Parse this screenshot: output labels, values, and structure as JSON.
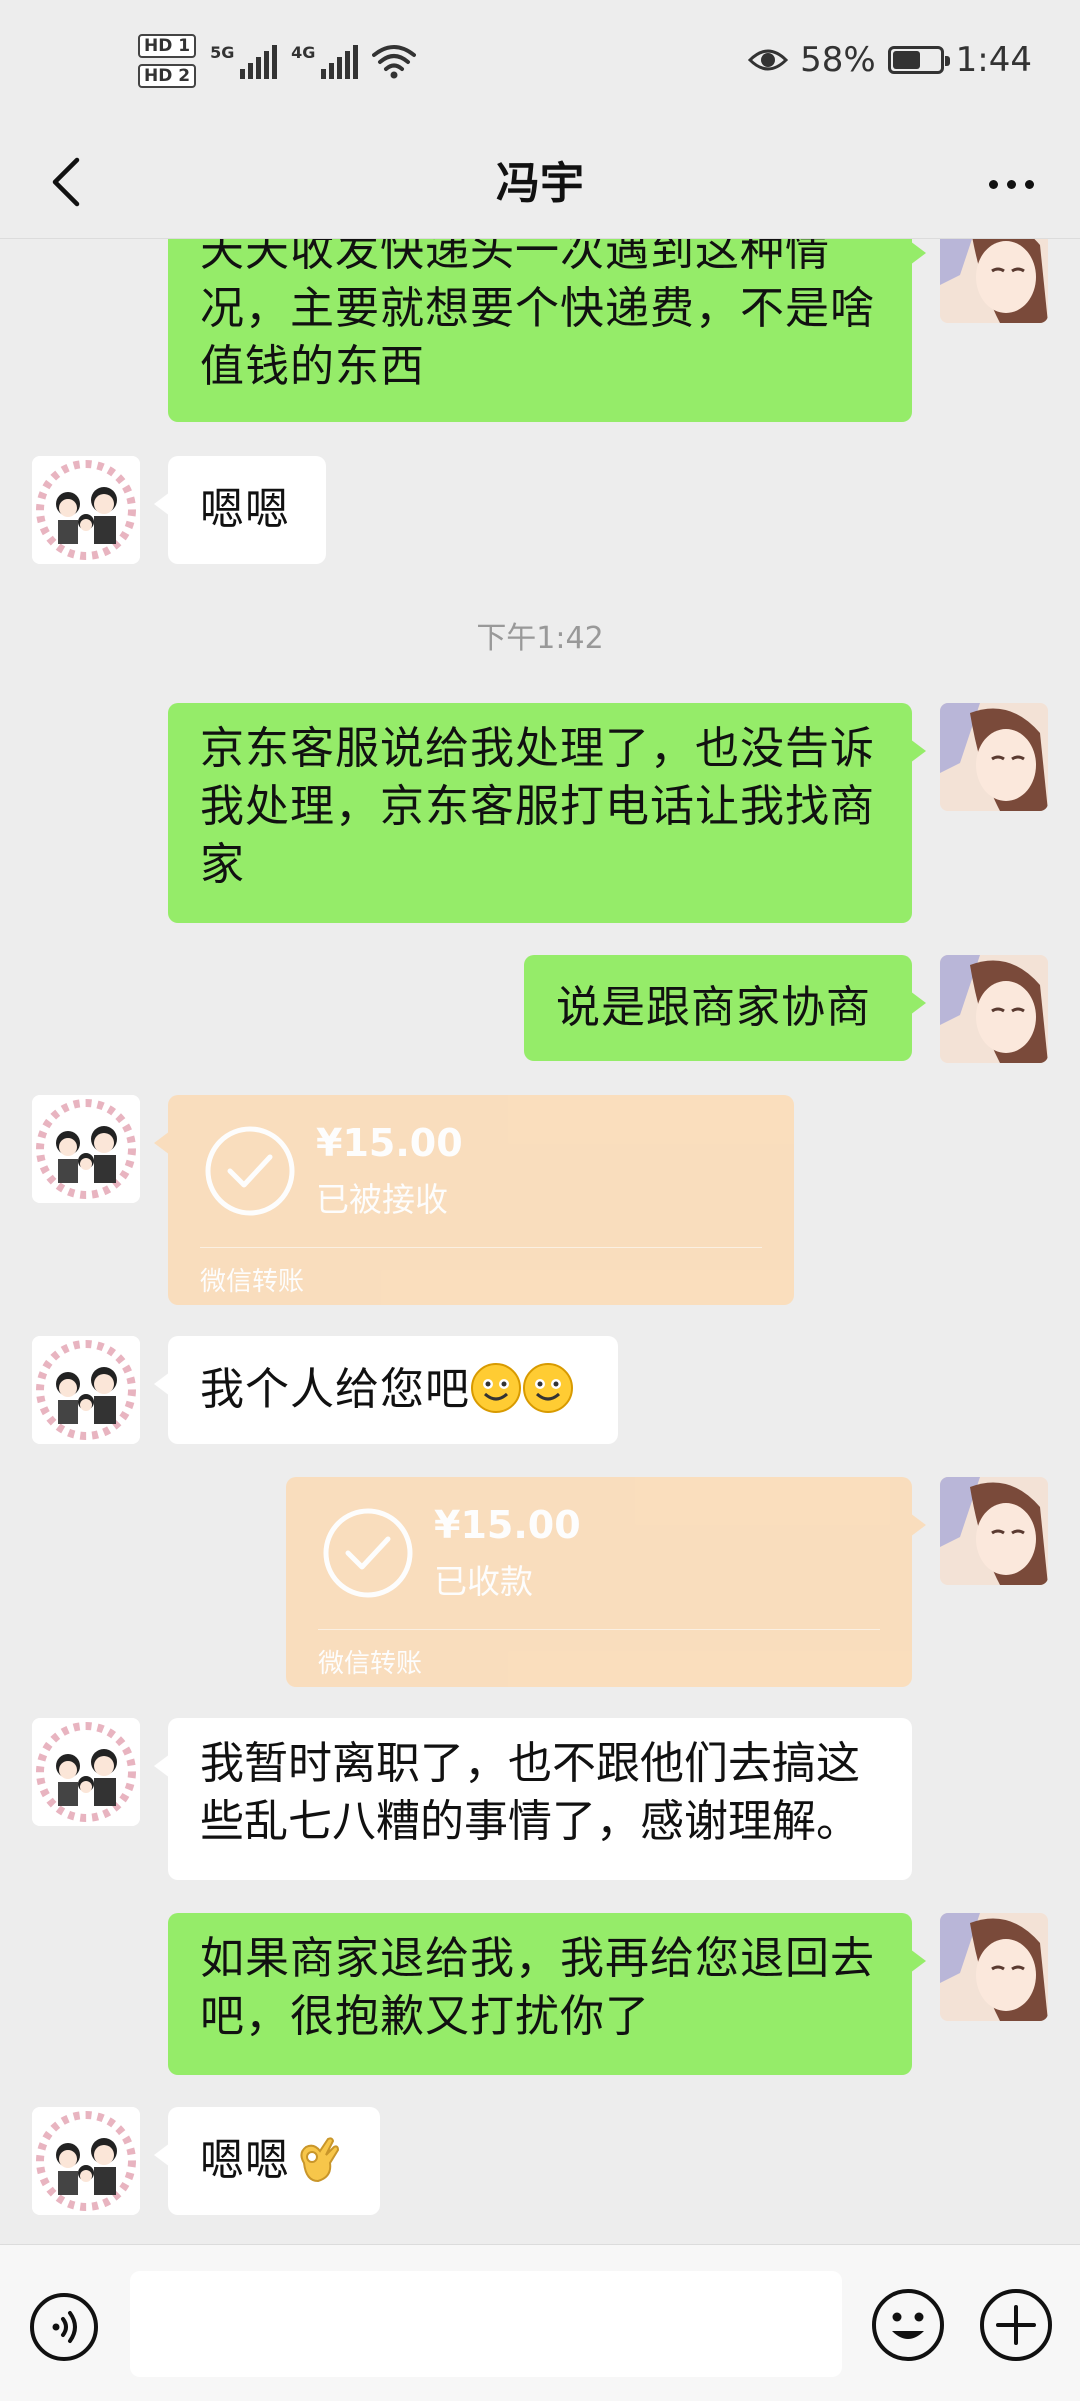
{
  "status_bar": {
    "sim1": "HD 1",
    "sim2": "HD 2",
    "net1": "5G",
    "net2": "4G",
    "battery": "58%",
    "battery_level": 0.58,
    "time": "1:44",
    "icons": [
      "eye-icon",
      "wifi-icon",
      "battery-icon"
    ]
  },
  "header": {
    "title": "冯宇",
    "back_icon": "chevron-left-icon",
    "more_icon": "more-dots-icon"
  },
  "messages": [
    {
      "type": "text",
      "side": "me",
      "text": "天天收发快递头一次遇到这种情况，主要就想要个快递费，不是啥值钱的东西"
    },
    {
      "type": "text",
      "side": "them",
      "text": "嗯嗯"
    },
    {
      "type": "time",
      "text": "下午1:42"
    },
    {
      "type": "text",
      "side": "me",
      "text": "京东客服说给我处理了，也没告诉我处理，京东客服打电话让我找商家"
    },
    {
      "type": "text",
      "side": "me",
      "text": "说是跟商家协商"
    },
    {
      "type": "transfer",
      "side": "them",
      "amount": "¥15.00",
      "status": "已被接收",
      "footer": "微信转账"
    },
    {
      "type": "text",
      "side": "them",
      "text": "我个人给您吧",
      "emoji": [
        "smile-emoji",
        "smile-emoji"
      ]
    },
    {
      "type": "transfer",
      "side": "me",
      "amount": "¥15.00",
      "status": "已收款",
      "footer": "微信转账"
    },
    {
      "type": "text",
      "side": "them",
      "text": "我暂时离职了，也不跟他们去搞这些乱七八糟的事情了，感谢理解。"
    },
    {
      "type": "text",
      "side": "me",
      "text": "如果商家退给我，我再给您退回去吧，很抱歉又打扰你了"
    },
    {
      "type": "text",
      "side": "them",
      "text": "嗯嗯",
      "emoji": [
        "ok-hand-emoji"
      ]
    }
  ],
  "input_bar": {
    "voice_icon": "voice-icon",
    "input_value": "",
    "emoji_icon": "emoji-icon",
    "plus_icon": "plus-icon"
  },
  "colors": {
    "background": "#ededed",
    "my_bubble": "#95ec69",
    "their_bubble": "#ffffff",
    "transfer": "#fbdcb9",
    "timestamp": "#999999"
  }
}
